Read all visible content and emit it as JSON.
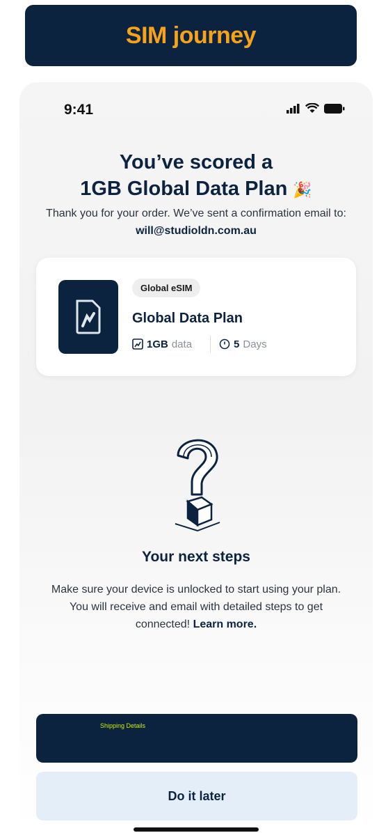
{
  "banner": {
    "title": "SIM journey"
  },
  "status_bar": {
    "time": "9:41",
    "icons": [
      "signal-icon",
      "wifi-icon",
      "battery-icon"
    ]
  },
  "confirmation": {
    "headline_line1": "You’ve scored a",
    "headline_line2": "1GB Global Data Plan",
    "headline_emoji": "🎉",
    "thank_you": "Thank you for your order. We’ve sent a confirmation email to:",
    "email": "will@studioldn.com.au"
  },
  "plan_card": {
    "badge": "Global eSIM",
    "name": "Global Data Plan",
    "data_value": "1GB",
    "data_unit": "data",
    "days_value": "5",
    "days_unit": "Days",
    "icon": "sim-card-icon"
  },
  "next_steps": {
    "icon": "question-mark-icon",
    "title": "Your next steps",
    "text": "Make sure your device is unlocked to start using your plan. You will receive and email with detailed steps to get connected!",
    "link": "Learn more."
  },
  "buttons": {
    "primary": "Shipping Details",
    "secondary": "Do it later"
  },
  "colors": {
    "navy": "#0c2340",
    "accent": "#f6a21a",
    "secondary_bg": "#e4eef8"
  }
}
